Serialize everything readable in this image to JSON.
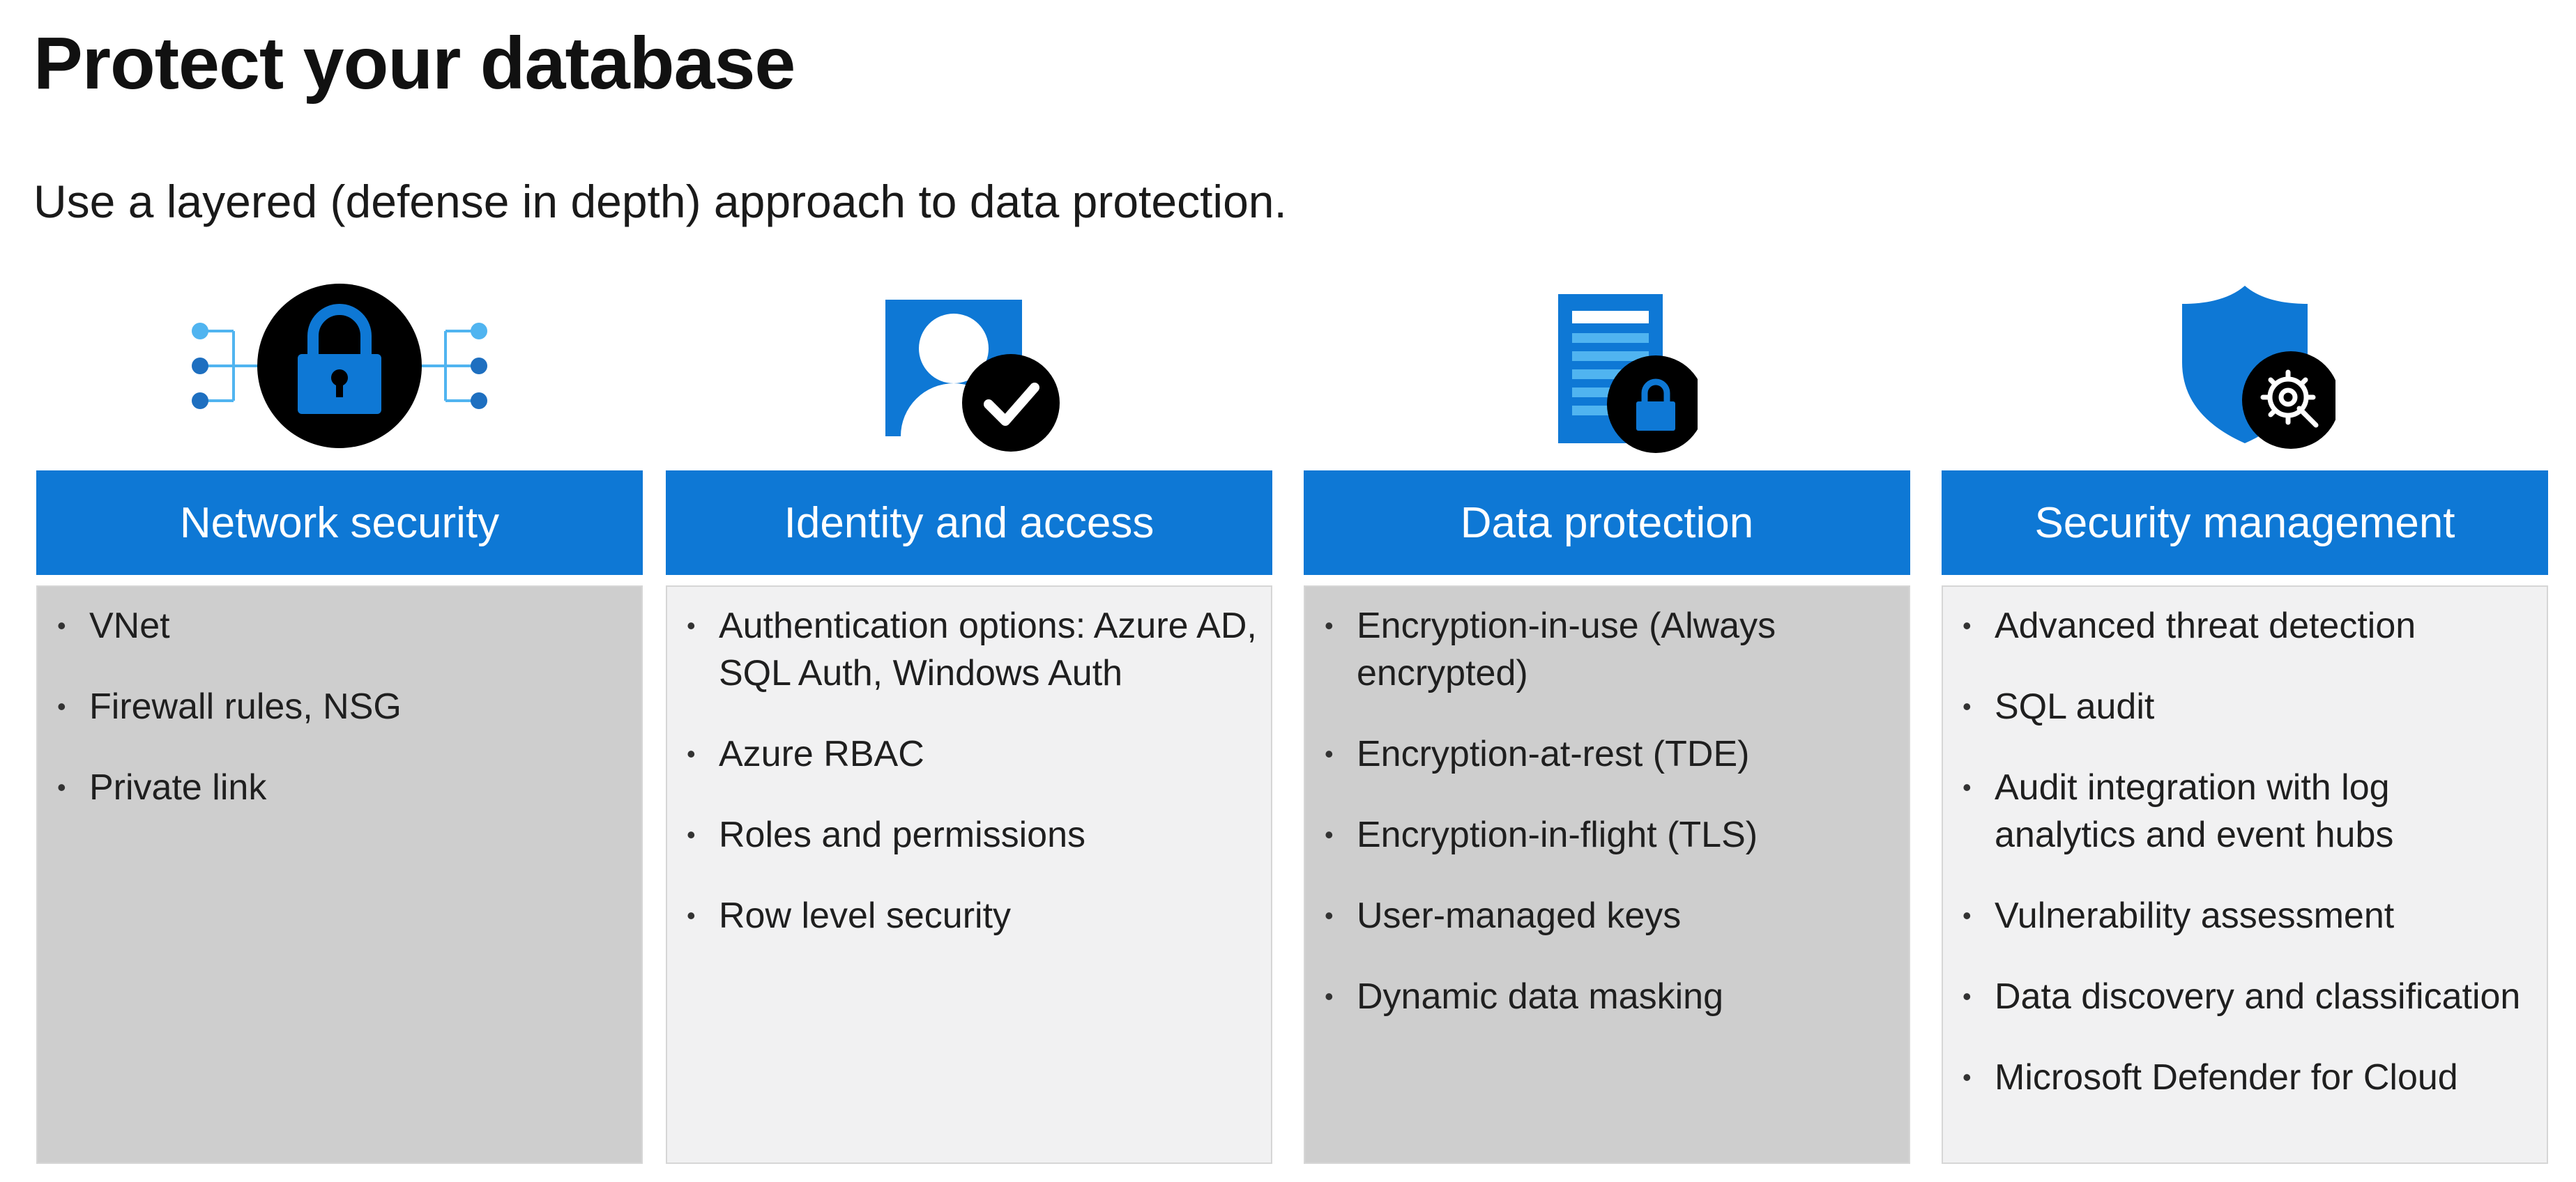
{
  "slide": {
    "title": "Protect your database",
    "subtitle": "Use a layered (defense in depth) approach to data protection."
  },
  "colors": {
    "accent": "#0e78d5",
    "icon_dark": "#000000",
    "icon_light_blue": "#50b4f0",
    "panel_dark": "#cecece",
    "panel_light": "#f1f1f2"
  },
  "pillars": [
    {
      "icon": "network-lock-icon",
      "title": "Network security",
      "items": [
        "VNet",
        "Firewall rules, NSG",
        "Private link"
      ]
    },
    {
      "icon": "identity-check-icon",
      "title": "Identity and access",
      "items": [
        "Authentication options: Azure AD, SQL Auth, Windows Auth",
        "Azure RBAC",
        "Roles and permissions",
        "Row level security"
      ]
    },
    {
      "icon": "document-lock-icon",
      "title": "Data protection",
      "items": [
        "Encryption-in-use (Always encrypted)",
        "Encryption-at-rest (TDE)",
        "Encryption-in-flight (TLS)",
        "User-managed keys",
        "Dynamic data masking"
      ]
    },
    {
      "icon": "shield-gear-icon",
      "title": "Security management",
      "items": [
        "Advanced threat detection",
        "SQL audit",
        "Audit integration with log analytics and event hubs",
        "Vulnerability assessment",
        "Data discovery and classification",
        "Microsoft Defender for Cloud"
      ]
    }
  ]
}
